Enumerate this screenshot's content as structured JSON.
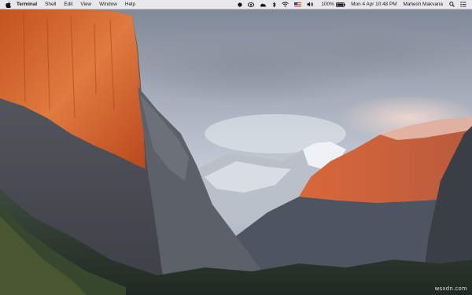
{
  "menubar": {
    "app_name": "Terminal",
    "menus": [
      "Shell",
      "Edit",
      "View",
      "Window",
      "Help"
    ],
    "status_icons": [
      "record-icon",
      "eye-icon",
      "cloud-icon",
      "bluetooth-icon",
      "wifi-icon",
      "flag-icon",
      "volume-icon"
    ],
    "battery": "100%",
    "datetime": "Mon 4 Apr  10:48 PM",
    "user": "Mahesh Makvana"
  },
  "watermark": "wsxdn.com"
}
